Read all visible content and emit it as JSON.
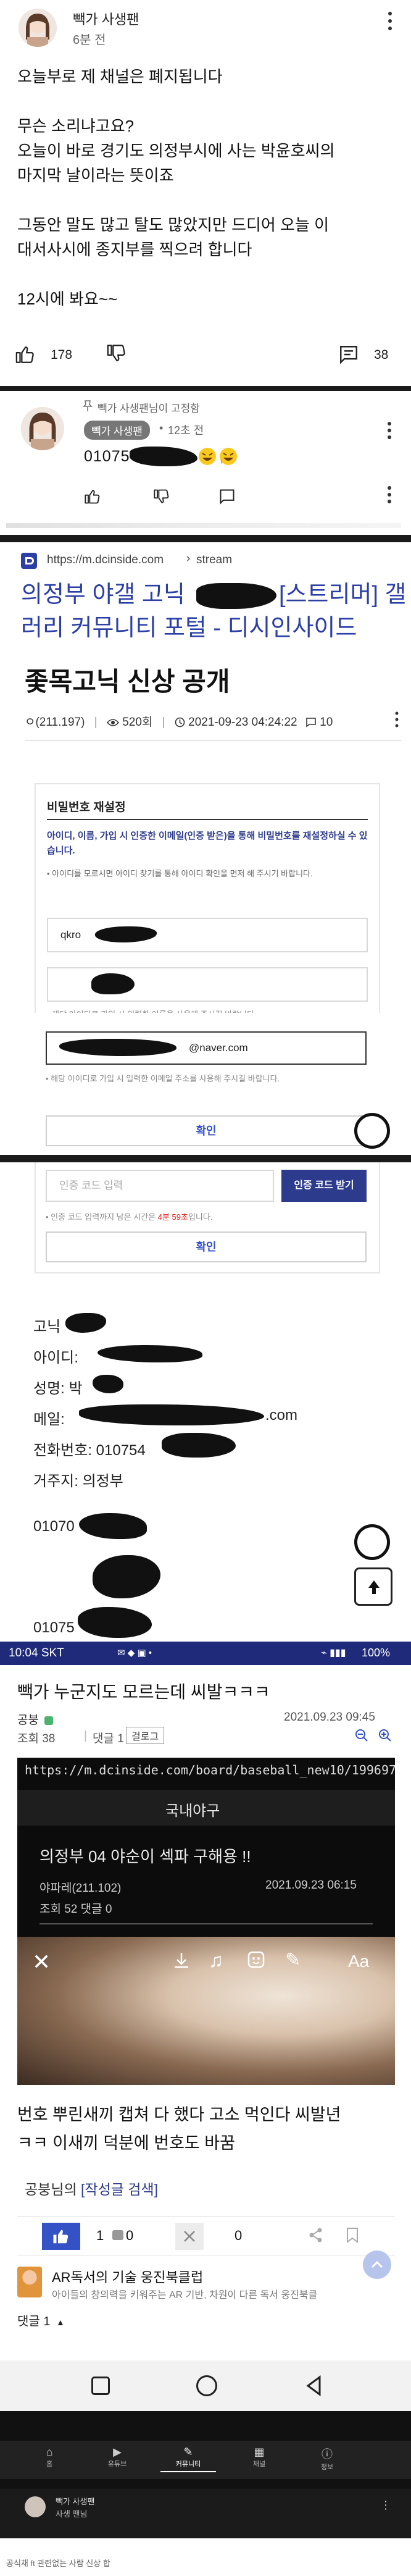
{
  "post": {
    "author": "빽가 사생팬",
    "time": "6분 전",
    "lines": [
      "오늘부로 제 채널은 폐지됩니다",
      "",
      "무슨 소리냐고요?",
      "오늘이 바로 경기도 의정부시에 사는 박윤호씨의",
      "마지막 날이라는 뜻이죠",
      "",
      "그동안 말도 많고 탈도 많았지만 드디어 오늘 이",
      "대서사시에 종지부를 찍으려 합니다",
      "",
      "12시에 봐요~~"
    ],
    "like_count": "178",
    "comment_count": "38"
  },
  "comment": {
    "pinned_label": "빽가 사생팬님이 고정함",
    "author_badge": "빽가 사생팬",
    "time": "12초 전",
    "text": "01075"
  },
  "browser": {
    "url": "https://m.dcinside.com",
    "stream_label": "stream",
    "title_part1": "의정부 야갤 고닉",
    "title_part2": "[스트리머] 갤",
    "title_line2": "러리 커뮤니티 포털 - 디시인사이드",
    "headline": "좇목고닉 신상 공개",
    "meta_user": "ㅇ(211.197)",
    "views": "520회",
    "date": "2021-09-23 04:24:22",
    "comments": "10"
  },
  "pw_form": {
    "title": "비밀번호 재설정",
    "desc_1": "아이디, 이름, 가입 시 인증한 이메일(인증 받은)을 통해 비밀번호를 재설정하실 수 있습니다.",
    "desc_2": "아이디를 모르시면 아이디 찾기를 통해 아이디 확인을 먼저 해 주시기 바랍니다.",
    "id_value": "qkro",
    "name_hint": "해당 아이디로 가입 시 입력한 이름을 사용해 주시길 바랍니다.",
    "email_value": "@naver.com",
    "email_hint": "해당 아이디로 가입 시 입력한 이메일 주소를 사용해 주시길 바랍니다.",
    "confirm": "확인",
    "code_placeholder": "인증 코드 입력",
    "code_button": "인증 코드 받기",
    "code_hint_pre": "인증 코드 입력까지 남은 시간은",
    "code_time": "4분 59초",
    "code_hint_post": "입니다.",
    "confirm2": "확인"
  },
  "info": {
    "nick": "고닉",
    "id_label": "아이디:",
    "name_label": "성명: 박",
    "mail_label": "메일:",
    "mail_suffix": ".com",
    "phone_label": "전화번호: 010754",
    "residence": "거주지: 의정부",
    "num1": "01070",
    "num2": "01075"
  },
  "screenshot2": {
    "status_time": "10:04 SKT",
    "battery": "100%",
    "title": "빽가 누군지도 모르는데 씨발ㅋㅋㅋ",
    "author": "공붕",
    "date": "2021.09.23 09:45",
    "views": "조회 38",
    "comments": "댓글 1",
    "report": "걸로그",
    "inner_url": "https://m.dcinside.com/board/baseball_new10/19969753",
    "inner_gallery": "국내야구",
    "inner_title": "의정부 04 야순이 섹파 구해용 !!",
    "inner_author": "야파레(211.102)",
    "inner_date": "2021.09.23 06:15",
    "inner_stats": "조회 52  댓글 0",
    "aa": "Aa",
    "body_line1": "번호 뿌린새끼 캡쳐 다 했다 고소 먹인다 씨발년",
    "body_line2": "ㅋㅋ 이새끼 덕분에 번호도 바꿈",
    "sig_name": "공붕님의",
    "sig_link": "[작성글 검색]",
    "up_count": "1",
    "up_small": "0",
    "down_count": "0",
    "ad_title": "AR독서의 기술 웅진북클럽",
    "ad_desc": "아이들의 창의력을 키워주는 AR 기반, 차원이 다른 독서 웅진북클",
    "comment_count_label": "댓글 1"
  },
  "footer": {
    "tabs": [
      "홈",
      "유튜브",
      "커뮤니티",
      "채널",
      "정보"
    ],
    "mini_author": "빽가 사생팬",
    "mini_text": "사생 팬님",
    "caption": "공식채 ft 관련없는 사람 신상 합"
  },
  "colors": {
    "accent_blue": "#3451c6",
    "dc_blue": "#2c3fa5",
    "navy": "#2d3b8c",
    "red": "#e2231a",
    "phone_bar": "#1f2a7a"
  }
}
